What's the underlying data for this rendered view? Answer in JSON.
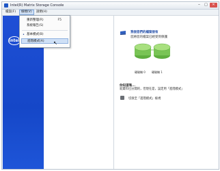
{
  "window": {
    "title": "Intel(R) Matrix Storage Console"
  },
  "menubar": {
    "file": "檔案(F)",
    "mode": "檢視(V)",
    "help": "說明(H)"
  },
  "dropdown": {
    "items": [
      {
        "label": "重新整理(R)",
        "shortcut": "F5"
      },
      {
        "label": "系統報告(S)",
        "shortcut": ""
      },
      {
        "label": "基本模式(B)",
        "shortcut": "",
        "checked": true
      },
      {
        "label": "進階模式(A)",
        "shortcut": ""
      }
    ]
  },
  "sidebar": {
    "logo": "intel"
  },
  "right": {
    "title": "我很您們的檔案很有",
    "subtitle": "您將您的檔案已經受到保護",
    "disk_labels": [
      "硬碟機 0",
      "硬碟機 1"
    ],
    "note_title": "你知道嗎...",
    "note_text": "就資料已分開的，但現在是，設定用「進階模式」",
    "link_text": "切換至「進階模式」檢視"
  },
  "colors": {
    "sidebar_blue": "#1f4fd6",
    "disk_green": "#8fd36a",
    "highlight": "#cfe0f6"
  }
}
